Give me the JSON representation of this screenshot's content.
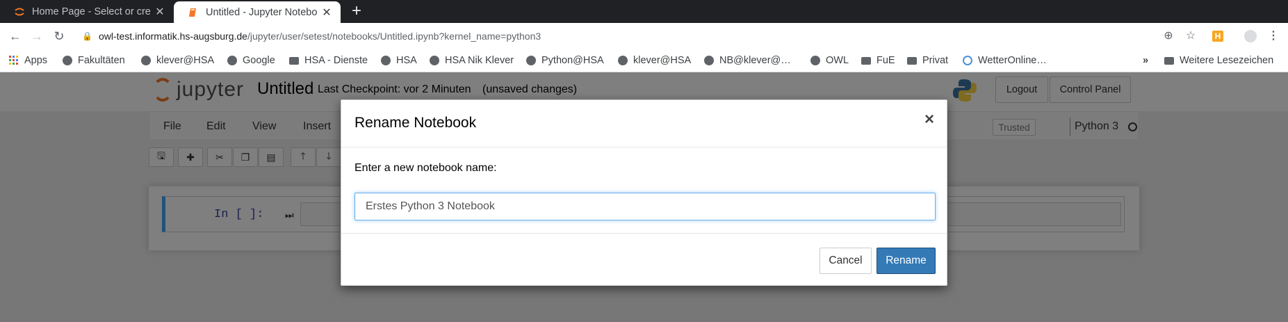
{
  "browser": {
    "tabs": [
      {
        "title": "Home Page - Select or cre",
        "close": "✕"
      },
      {
        "title": "Untitled - Jupyter Notebo",
        "close": "✕"
      }
    ],
    "new_tab": "+",
    "address": {
      "host": "owl-test.informatik.hs-augsburg.de",
      "path": "/jupyter/user/setest/notebooks/Untitled.ipynb?kernel_name=python3"
    },
    "bookmarks": [
      {
        "label": "Apps",
        "icon": "apps-grid-icon"
      },
      {
        "label": "Fakultäten",
        "icon": "globe-icon"
      },
      {
        "label": "klever@HSA",
        "icon": "globe-icon"
      },
      {
        "label": "Google",
        "icon": "globe-icon"
      },
      {
        "label": "HSA - Dienste",
        "icon": "folder-icon"
      },
      {
        "label": "HSA",
        "icon": "globe-icon"
      },
      {
        "label": "HSA Nik Klever",
        "icon": "globe-icon"
      },
      {
        "label": "Python@HSA",
        "icon": "globe-icon"
      },
      {
        "label": "klever@HSA",
        "icon": "globe-icon"
      },
      {
        "label": "NB@klever@…",
        "icon": "globe-icon"
      },
      {
        "label": "OWL",
        "icon": "globe-icon"
      },
      {
        "label": "FuE",
        "icon": "folder-icon"
      },
      {
        "label": "Privat",
        "icon": "folder-icon"
      },
      {
        "label": "WetterOnline…",
        "icon": "weather-icon"
      }
    ],
    "bookmarks_more": "»",
    "other_bookmarks": "Weitere Lesezeichen"
  },
  "jupyter": {
    "logo_text": "jupyter",
    "notebook_name": "Untitled",
    "checkpoint": "Last Checkpoint: vor 2 Minuten",
    "unsaved": "(unsaved changes)",
    "logout": "Logout",
    "control_panel": "Control Panel",
    "menus": [
      "File",
      "Edit",
      "View",
      "Insert"
    ],
    "trusted": "Trusted",
    "kernel": "Python 3",
    "cell_prompt": "In [ ]:"
  },
  "modal": {
    "title": "Rename Notebook",
    "close": "×",
    "label": "Enter a new notebook name:",
    "input_value": "Erstes Python 3 Notebook",
    "cancel": "Cancel",
    "rename": "Rename"
  },
  "colors": {
    "primary_button": "#337ab7",
    "jupyter_orange": "#f37726",
    "cell_selected_border": "#42a5f5"
  }
}
